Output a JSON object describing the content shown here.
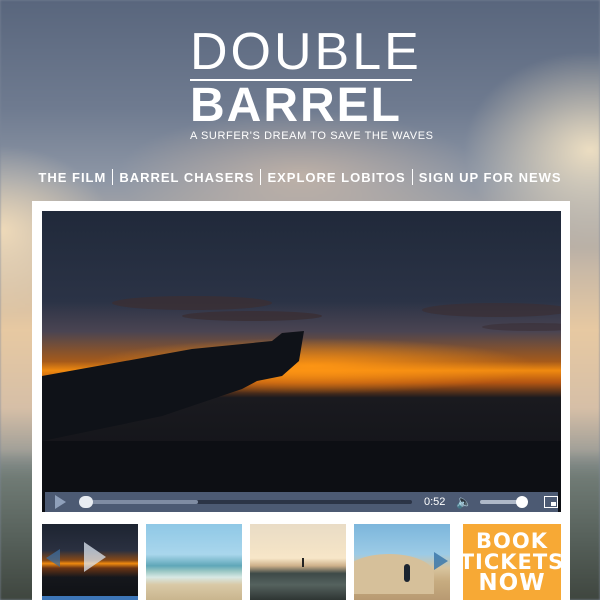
{
  "brand": {
    "line1": "DOUBLE",
    "line2": "BARREL",
    "tagline": "A SURFER'S DREAM TO SAVE THE WAVES"
  },
  "nav": {
    "items": [
      {
        "label": "THE FILM"
      },
      {
        "label": "BARREL CHASERS"
      },
      {
        "label": "EXPLORE LOBITOS"
      },
      {
        "label": "SIGN UP FOR NEWS"
      }
    ]
  },
  "player": {
    "time": "0:52",
    "progress": 0.0,
    "buffered": 0.35,
    "volume": 1.0,
    "icons": {
      "play": "play-icon",
      "volume": "volume-icon",
      "fullscreen": "fullscreen-icon"
    }
  },
  "thumbnails": [
    {
      "name": "sunset-wing-thumbnail",
      "active": true
    },
    {
      "name": "beach-waves-thumbnail"
    },
    {
      "name": "surfer-sunset-thumbnail"
    },
    {
      "name": "dune-surfer-thumbnail"
    }
  ],
  "cta": {
    "line1": "BOOK",
    "line2": "TICKETS",
    "line3": "NOW",
    "color": "#f7a935"
  },
  "colors": {
    "controls_bar": "#4c5a73",
    "accent": "#3d76b8"
  }
}
